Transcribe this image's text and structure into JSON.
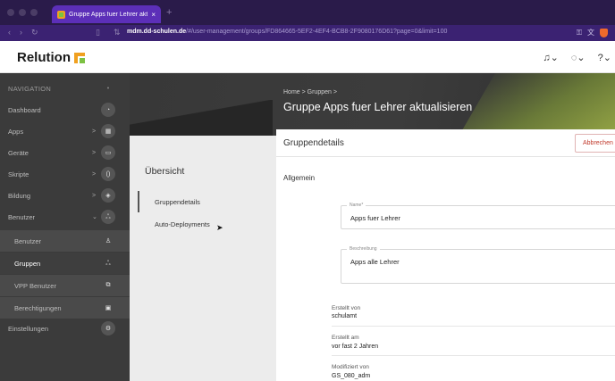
{
  "browser": {
    "tab_title": "Gruppe Apps fuer Lehrer akt",
    "tab_close": "×",
    "new_tab": "+",
    "url_domain": "mdm.dd-schulen.de",
    "url_path": "/#/user-management/groups/FD864665-5EF2-4EF4-BCB8-2F9080176D61?page=0&limit=100",
    "icons": [
      "back-icon",
      "forward-icon",
      "reload-icon",
      "bookmark-icon",
      "site-settings-icon",
      "key-icon",
      "translate-icon",
      "brave-icon"
    ]
  },
  "app": {
    "logo_text": "Relution",
    "header_icons": [
      "bell-icon",
      "chat-icon",
      "help-icon"
    ]
  },
  "sidebar": {
    "header": "NAVIGATION",
    "items": [
      {
        "label": "Dashboard",
        "icon": "dashboard-icon"
      },
      {
        "label": "Apps",
        "icon": "apps-grid-icon",
        "chevron": ">"
      },
      {
        "label": "Geräte",
        "icon": "devices-icon",
        "chevron": ">"
      },
      {
        "label": "Skripte",
        "icon": "code-icon",
        "chevron": ">"
      },
      {
        "label": "Bildung",
        "icon": "education-icon",
        "chevron": ">"
      },
      {
        "label": "Benutzer",
        "icon": "users-icon",
        "chevron": "⌄"
      }
    ],
    "subitems": [
      {
        "label": "Benutzer",
        "icon": "user-icon"
      },
      {
        "label": "Gruppen",
        "icon": "group-icon",
        "active": true
      },
      {
        "label": "VPP Benutzer",
        "icon": "vpp-icon"
      },
      {
        "label": "Berechtigungen",
        "icon": "permissions-icon"
      }
    ],
    "settings": {
      "label": "Einstellungen",
      "icon": "settings-icon"
    }
  },
  "page": {
    "breadcrumb": "Home > Gruppen >",
    "title": "Gruppe Apps fuer Lehrer aktualisieren"
  },
  "overview": {
    "title": "Übersicht",
    "items": [
      "Gruppendetails",
      "Auto-Deployments"
    ]
  },
  "details": {
    "card_title": "Gruppendetails",
    "cancel_label": "Abbrechen",
    "section": "Allgemein",
    "name_label": "Name*",
    "name_value": "Apps fuer Lehrer",
    "desc_label": "Beschreibung",
    "desc_value": "Apps alle Lehrer",
    "created_by_label": "Erstellt von",
    "created_by_value": "schulamt",
    "created_at_label": "Erstellt am",
    "created_at_value": "vor fast 2 Jahren",
    "modified_by_label": "Modifiziert von",
    "modified_by_value": "GS_080_adm"
  }
}
